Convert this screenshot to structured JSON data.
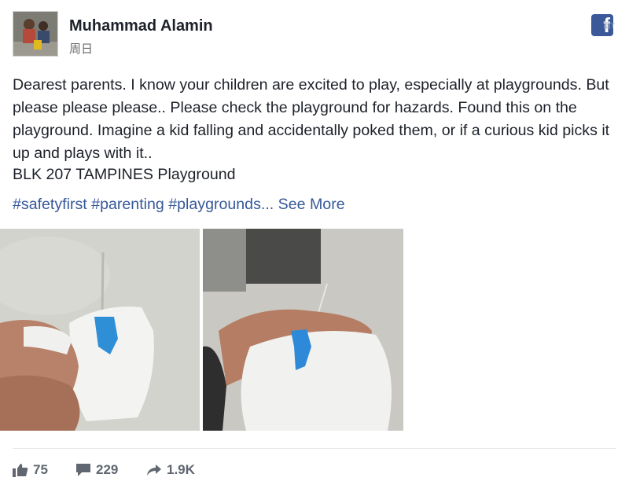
{
  "post": {
    "author": "Muhammad Alamin",
    "timestamp": "周日",
    "corner_mark": "翻T",
    "text": "Dearest parents. I know your children are excited to play, especially at playgrounds. But please please please.. Please check the playground for hazards. Found this on the playground. Imagine a kid falling and accidentally poked them, or if a curious kid picks it up and plays with it..",
    "location": "BLK 207 TAMPINES Playground",
    "tags": "#safetyfirst #parenting #playgrounds...",
    "see_more": " See More"
  },
  "icons": {
    "platform": "facebook-icon",
    "like": "thumbs-up-icon",
    "comment": "speech-bubble-icon",
    "share": "share-arrow-icon"
  },
  "stats": {
    "likes": "75",
    "comments": "229",
    "shares": "1.9K"
  },
  "colors": {
    "link": "#365899",
    "facebook_blue": "#3b5998",
    "muted": "#606770"
  }
}
